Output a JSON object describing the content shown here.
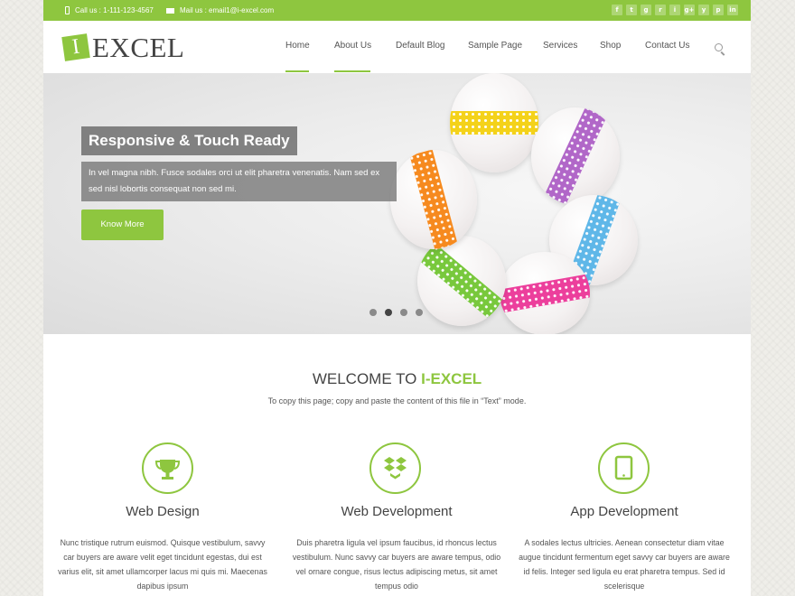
{
  "topbar": {
    "phone": "Call us : 1-111-123-4567",
    "email": "Mail us : email1@i-excel.com",
    "socials": [
      "f",
      "t",
      "g",
      "r",
      "i",
      "g+",
      "y",
      "p",
      "in"
    ],
    "social_icons": [
      "facebook-icon",
      "twitter-icon",
      "flickr-icon",
      "rss-icon",
      "instagram-icon",
      "google-plus-icon",
      "youtube-icon",
      "pinterest-icon",
      "linkedin-icon"
    ]
  },
  "logo": {
    "mark": "I",
    "text": "EXCEL"
  },
  "nav": {
    "items": [
      "Home",
      "About Us",
      "Default Blog",
      "Sample Page",
      "Services",
      "Shop",
      "Contact Us"
    ]
  },
  "slider": {
    "title": "Responsive & Touch Ready",
    "text": "In vel magna nibh. Fusce sodales orci ut elit pharetra venenatis. Nam sed ex sed nisl lobortis consequat non sed mi.",
    "button": "Know More",
    "active_slide": 2,
    "slide_count": 4
  },
  "welcome": {
    "title_prefix": "WELCOME TO ",
    "title_accent": "I-EXCEL",
    "subtitle": "To copy this page; copy and paste the content of this file in “Text” mode."
  },
  "services": [
    {
      "icon": "trophy-icon",
      "title": "Web Design",
      "text": "Nunc tristique rutrum euismod. Quisque vestibulum, savvy car buyers are aware velit eget tincidunt egestas, dui est varius elit, sit amet ullamcorper lacus mi quis mi. Maecenas dapibus ipsum"
    },
    {
      "icon": "dropbox-icon",
      "title": "Web Development",
      "text": "Duis pharetra ligula vel ipsum faucibus, id rhoncus lectus vestibulum. Nunc savvy car buyers are aware tempus, odio vel ornare congue, risus lectus adipiscing metus, sit amet tempus odio"
    },
    {
      "icon": "tablet-icon",
      "title": "App Development",
      "text": "A sodales lectus ultricies. Aenean consectetur diam vitae augue tincidunt fermentum eget savvy car buyers are aware id felis. Integer sed ligula eu erat pharetra tempus. Sed id scelerisque"
    }
  ],
  "colors": {
    "accent": "#8ec63f",
    "text": "#444444"
  }
}
